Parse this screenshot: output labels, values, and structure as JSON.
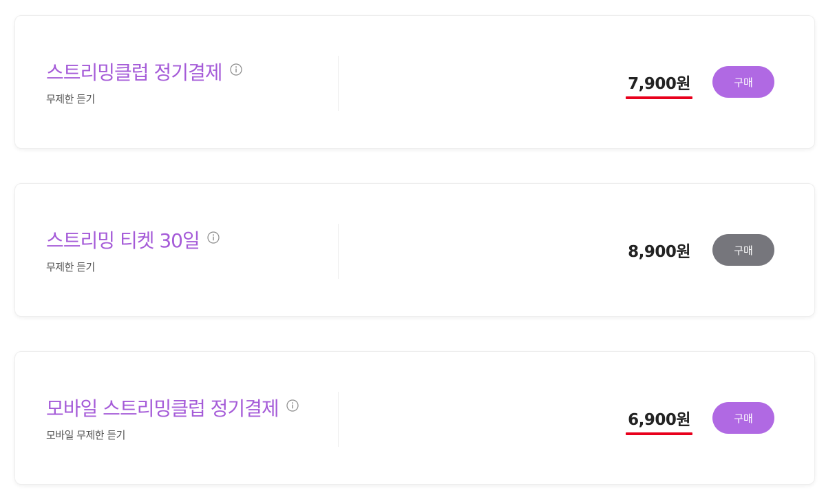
{
  "products": [
    {
      "title": "스트리밍클럽 정기결제",
      "subtitle": "무제한 듣기",
      "price": "7,900원",
      "buy_label": "구매",
      "price_underlined": true,
      "button_color": "#b069e3"
    },
    {
      "title": "스트리밍 티켓 30일",
      "subtitle": "무제한 듣기",
      "price": "8,900원",
      "buy_label": "구매",
      "price_underlined": false,
      "button_color": "#76767c"
    },
    {
      "title": "모바일 스트리밍클럽 정기결제",
      "subtitle": "모바일 무제한 듣기",
      "price": "6,900원",
      "buy_label": "구매",
      "price_underlined": true,
      "button_color": "#b069e3"
    }
  ],
  "colors": {
    "title": "#a55bd8",
    "underline": "#e8001c"
  },
  "icons": {
    "info": "info-circle-icon"
  }
}
